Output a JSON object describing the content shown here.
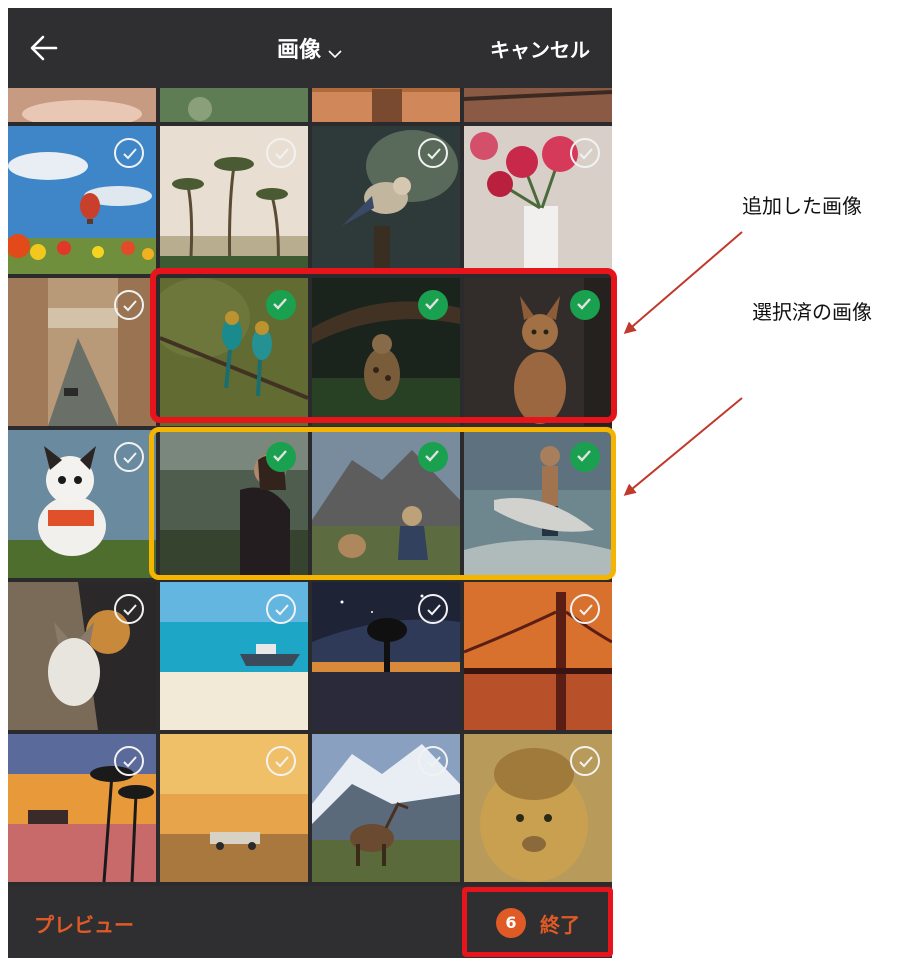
{
  "header": {
    "title": "画像",
    "cancel_label": "キャンセル"
  },
  "grid": {
    "rows": [
      {
        "partial": true,
        "tiles": [
          {
            "subject": "partial-photo",
            "checked": false
          },
          {
            "subject": "partial-photo",
            "checked": false
          },
          {
            "subject": "partial-photo",
            "checked": false
          },
          {
            "subject": "partial-photo",
            "checked": false
          }
        ]
      },
      {
        "tiles": [
          {
            "subject": "hot-air-balloon-tulips",
            "checked": false
          },
          {
            "subject": "palm-trees",
            "checked": false
          },
          {
            "subject": "jay-bird-on-post",
            "checked": false
          },
          {
            "subject": "pink-roses",
            "checked": false
          }
        ]
      },
      {
        "tiles": [
          {
            "subject": "venice-canal",
            "checked": false
          },
          {
            "subject": "bee-eater-birds",
            "checked": true
          },
          {
            "subject": "leopard-under-tree",
            "checked": true
          },
          {
            "subject": "abyssinian-cat",
            "checked": true
          }
        ]
      },
      {
        "tiles": [
          {
            "subject": "french-bulldog",
            "checked": false
          },
          {
            "subject": "woman-in-field",
            "checked": true
          },
          {
            "subject": "woman-and-dog-mountain",
            "checked": true
          },
          {
            "subject": "surfer-with-board",
            "checked": true
          }
        ]
      },
      {
        "tiles": [
          {
            "subject": "husky-with-owner",
            "checked": false
          },
          {
            "subject": "tropical-beach-boat",
            "checked": false
          },
          {
            "subject": "tree-under-milky-way",
            "checked": false
          },
          {
            "subject": "golden-gate-bridge",
            "checked": false
          }
        ]
      },
      {
        "tiles": [
          {
            "subject": "sunset-palms-house",
            "checked": false
          },
          {
            "subject": "vintage-car-desert",
            "checked": false
          },
          {
            "subject": "elk-mountains",
            "checked": false
          },
          {
            "subject": "lion",
            "checked": false
          }
        ]
      }
    ]
  },
  "footer": {
    "preview_label": "プレビュー",
    "count": "6",
    "done_label": "終了"
  },
  "annotations": {
    "added_images": "追加した画像",
    "selected_images": "選択済の画像"
  },
  "colors": {
    "accent": "#e05a26",
    "check_green": "#1eb85a",
    "frame_red": "#e8141c",
    "frame_gold": "#f5b400",
    "bar_bg": "#2f2f32"
  }
}
